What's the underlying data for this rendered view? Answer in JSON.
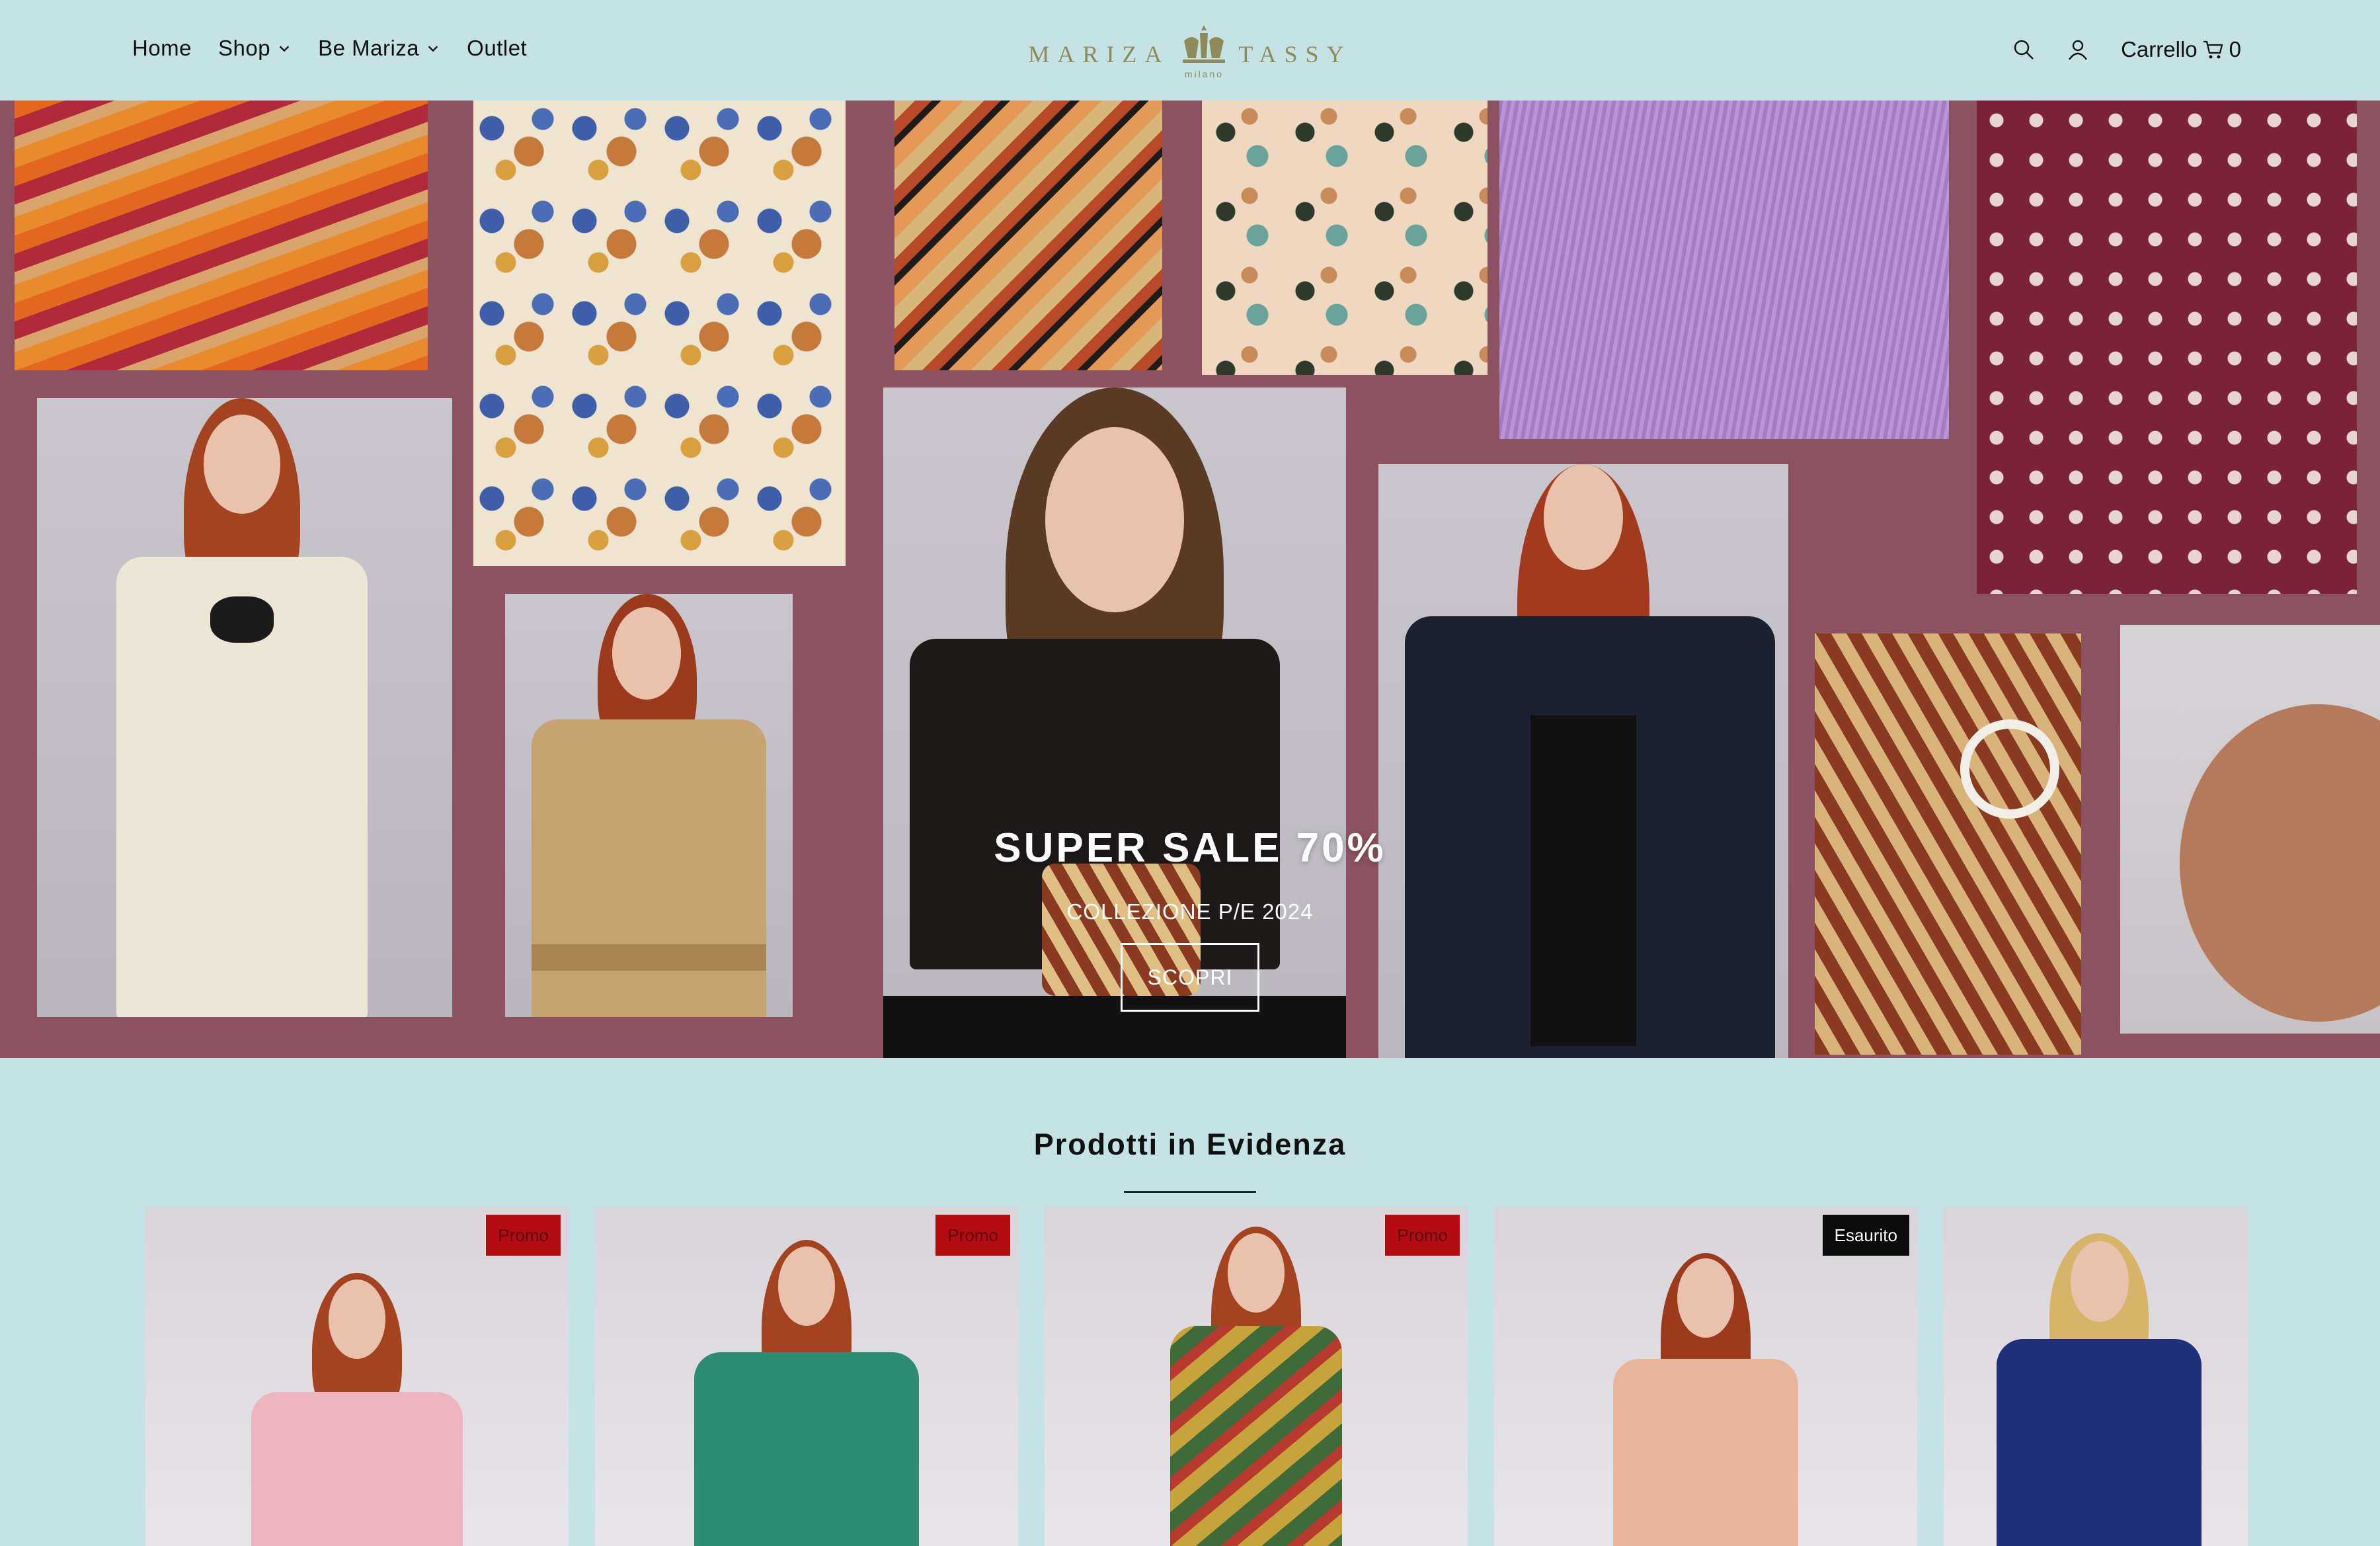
{
  "header": {
    "nav": [
      {
        "label": "Home",
        "has_dropdown": false
      },
      {
        "label": "Shop",
        "has_dropdown": true
      },
      {
        "label": "Be Mariza",
        "has_dropdown": true
      },
      {
        "label": "Outlet",
        "has_dropdown": false
      }
    ],
    "logo": {
      "left": "MARIZA",
      "right": "TASSY",
      "sub": "milano"
    },
    "cart_label": "Carrello",
    "cart_count": "0",
    "icons": [
      "search-icon",
      "account-icon",
      "cart-icon",
      "chevron-down-icon"
    ]
  },
  "hero": {
    "title": "SUPER SALE 70%",
    "subtitle": "COLLEZIONE P/E 2024",
    "button": "SCOPRI",
    "slides": 2,
    "active_slide": 1,
    "background": "#8c5261"
  },
  "featured": {
    "title": "Prodotti in Evidenza",
    "products": [
      {
        "badge": "Promo",
        "badge_type": "promo"
      },
      {
        "badge": "Promo",
        "badge_type": "promo"
      },
      {
        "badge": "Promo",
        "badge_type": "promo"
      },
      {
        "badge": "Esaurito",
        "badge_type": "soldout"
      },
      {
        "badge": "",
        "badge_type": "none"
      }
    ]
  },
  "colors": {
    "page_bg": "#c5e2e4",
    "logo": "#8e8a5a",
    "promo_badge": "#b40d11",
    "soldout_badge": "#0b0b0b"
  }
}
